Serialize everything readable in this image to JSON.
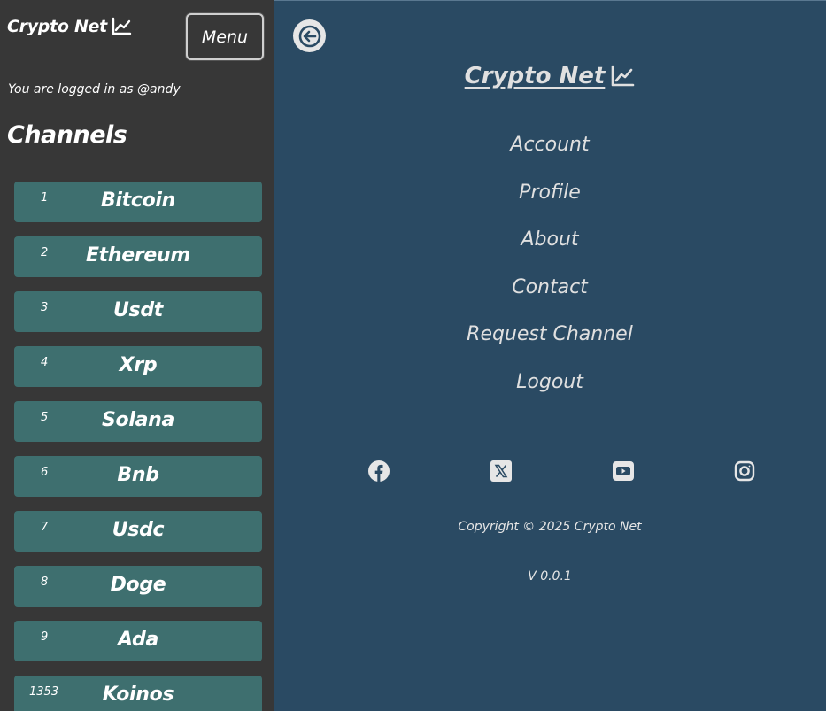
{
  "sidebar": {
    "brand": "Crypto Net",
    "brand_icon": "chart-line-icon",
    "menu_label": "Menu",
    "logged_in_text": "You are logged in as @andy",
    "channels_title": "Channels",
    "channels": [
      {
        "rank": "1",
        "name": "Bitcoin"
      },
      {
        "rank": "2",
        "name": "Ethereum"
      },
      {
        "rank": "3",
        "name": "Usdt"
      },
      {
        "rank": "4",
        "name": "Xrp"
      },
      {
        "rank": "5",
        "name": "Solana"
      },
      {
        "rank": "6",
        "name": "Bnb"
      },
      {
        "rank": "7",
        "name": "Usdc"
      },
      {
        "rank": "8",
        "name": "Doge"
      },
      {
        "rank": "9",
        "name": "Ada"
      },
      {
        "rank": "1353",
        "name": "Koinos"
      }
    ]
  },
  "main": {
    "back_icon": "arrow-left-icon",
    "brand": "Crypto Net",
    "nav": [
      "Account",
      "Profile",
      "About",
      "Contact",
      "Request Channel",
      "Logout"
    ],
    "social": [
      "facebook-icon",
      "x-icon",
      "youtube-icon",
      "instagram-icon"
    ],
    "copyright": "Copyright © 2025 Crypto Net",
    "version": "V 0.0.1"
  },
  "colors": {
    "sidebar_bg": "#373737",
    "main_bg": "#2a4a63",
    "channel_bg": "#3e6f6f"
  }
}
